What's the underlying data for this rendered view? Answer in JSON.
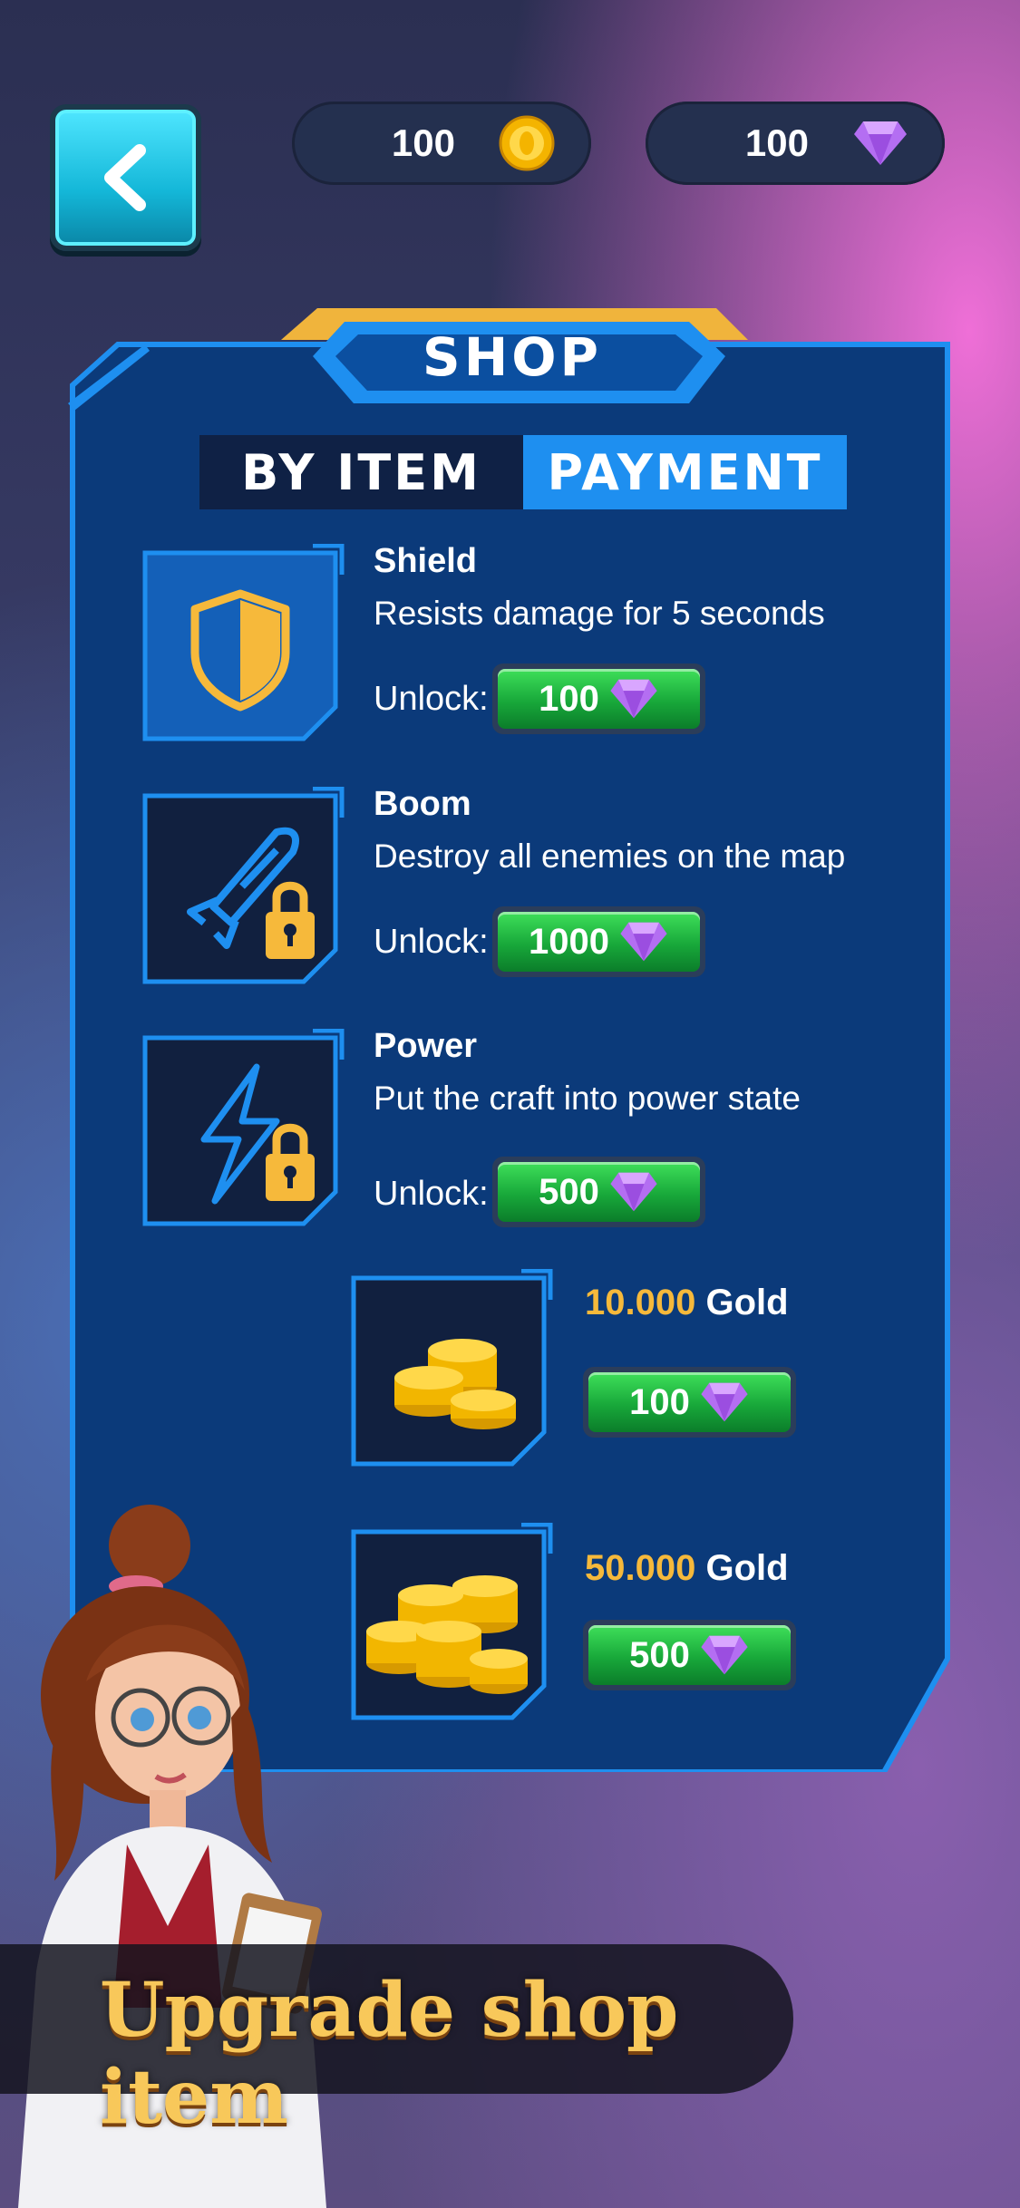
{
  "topbar": {
    "gold_amount": "100",
    "gem_amount": "100"
  },
  "shop": {
    "title": "SHOP",
    "tabs": [
      {
        "label": "BY ITEM",
        "active": false
      },
      {
        "label": "PAYMENT",
        "active": true
      }
    ],
    "unlock_label": "Unlock:",
    "items": [
      {
        "name": "Shield",
        "description": "Resists damage for 5 seconds",
        "price": "100",
        "icon": "shield-icon",
        "locked": false
      },
      {
        "name": "Boom",
        "description": "Destroy all enemies on the map",
        "price": "1000",
        "icon": "rocket-icon",
        "locked": true
      },
      {
        "name": "Power",
        "description": "Put the craft into power state",
        "price": "500",
        "icon": "lightning-icon",
        "locked": true
      }
    ],
    "gold_packs": [
      {
        "amount": "10.000",
        "unit": "Gold",
        "price": "100",
        "icon": "coin-stack-small-icon"
      },
      {
        "amount": "50.000",
        "unit": "Gold",
        "price": "500",
        "icon": "coin-stack-large-icon"
      }
    ]
  },
  "banner": {
    "text": "Upgrade shop item"
  },
  "colors": {
    "panel": "#0b3a7a",
    "panel_border": "#1e8ff0",
    "accent_gold": "#f6b93b",
    "button_green": "#18a83a",
    "gem": "#b46ef2"
  }
}
